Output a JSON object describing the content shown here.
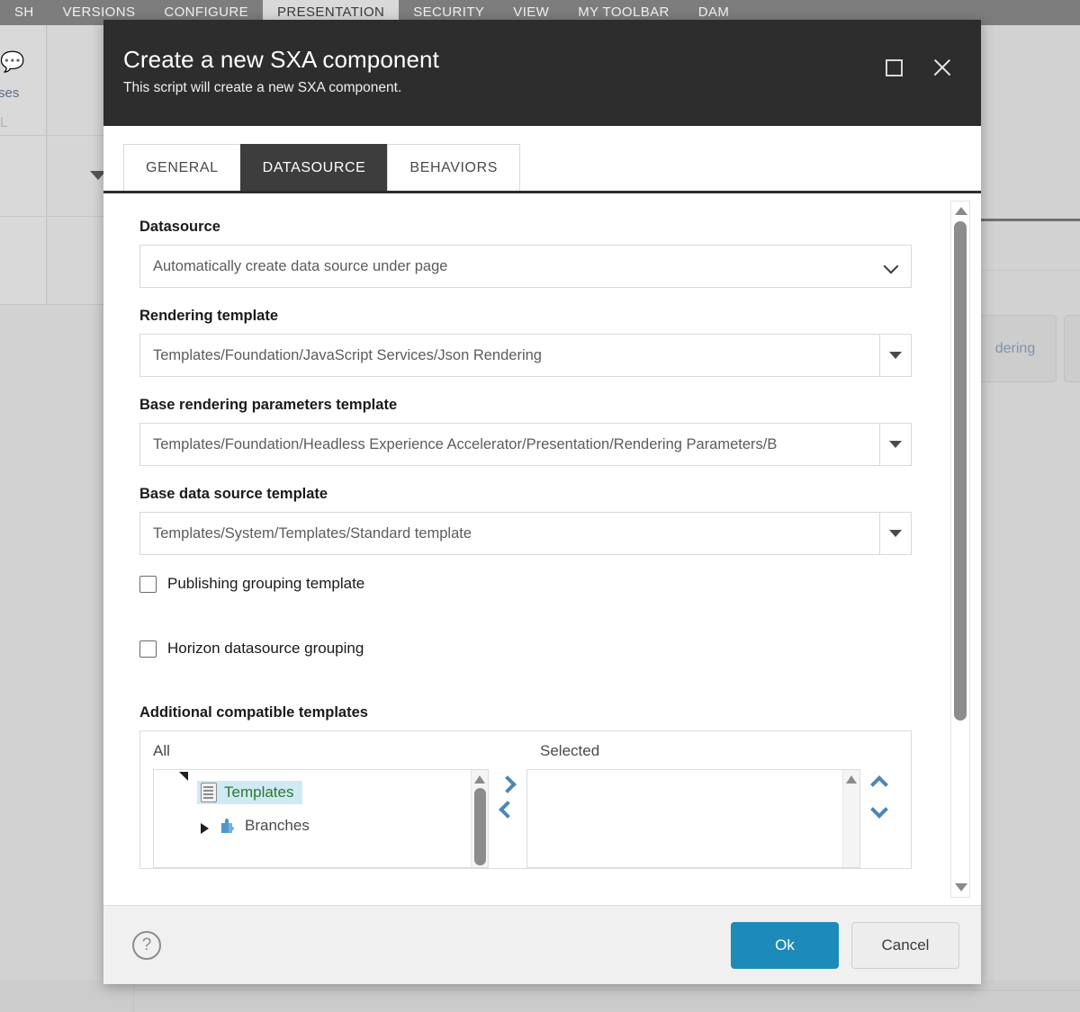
{
  "background": {
    "ribbon_tabs": [
      {
        "label": "SH",
        "active": false
      },
      {
        "label": "VERSIONS",
        "active": false
      },
      {
        "label": "CONFIGURE",
        "active": false
      },
      {
        "label": "PRESENTATION",
        "active": true
      },
      {
        "label": "SECURITY",
        "active": false
      },
      {
        "label": "VIEW",
        "active": false
      },
      {
        "label": "MY TOOLBAR",
        "active": false
      },
      {
        "label": "DAM",
        "active": false
      }
    ],
    "left_text_1": "ses",
    "left_text_2": "L",
    "right_chip_label": "dering",
    "ribbon_bg": "#7d7d7d",
    "ribbon_active_bg": "#d9d9d9"
  },
  "dialog": {
    "title": "Create a new SXA component",
    "subtitle": "This script will create a new SXA component.",
    "header_bg": "#2d2d2d",
    "maximize_icon": "maximize-icon",
    "close_icon": "close-icon",
    "tabs": [
      {
        "label": "GENERAL",
        "active": false
      },
      {
        "label": "DATASOURCE",
        "active": true
      },
      {
        "label": "BEHAVIORS",
        "active": false
      }
    ],
    "fields": {
      "datasource": {
        "label": "Datasource",
        "value": "Automatically create data source under page",
        "control": "select"
      },
      "rendering_template": {
        "label": "Rendering template",
        "value": "Templates/Foundation/JavaScript Services/Json Rendering",
        "control": "tree-picker"
      },
      "base_rendering_parameters_template": {
        "label": "Base rendering parameters template",
        "value": "Templates/Foundation/Headless Experience Accelerator/Presentation/Rendering Parameters/B",
        "control": "tree-picker"
      },
      "base_data_source_template": {
        "label": "Base data source template",
        "value": "Templates/System/Templates/Standard template",
        "control": "tree-picker"
      }
    },
    "checkboxes": [
      {
        "label": "Publishing grouping template",
        "checked": false
      },
      {
        "label": "Horizon datasource grouping",
        "checked": false
      }
    ],
    "dual_list": {
      "label": "Additional compatible templates",
      "all_header": "All",
      "selected_header": "Selected",
      "all_items": [
        {
          "label": "Templates",
          "icon": "template-icon",
          "expanded": true,
          "selected": true,
          "indent": 0,
          "color": "#2a7a2a"
        },
        {
          "label": "Branches",
          "icon": "branch-icon",
          "expanded": false,
          "selected": false,
          "indent": 1,
          "color": "#4a4a4a"
        }
      ],
      "selected_items": [],
      "transfer_right_icon": "chevron-right-icon",
      "transfer_left_icon": "chevron-left-icon",
      "move_up_icon": "chevron-up-icon",
      "move_down_icon": "chevron-down-icon",
      "accent": "#4a87b8"
    },
    "footer": {
      "help_icon": "help-icon",
      "help_glyph": "?",
      "ok_label": "Ok",
      "cancel_label": "Cancel",
      "ok_color": "#1d8bb9"
    }
  }
}
